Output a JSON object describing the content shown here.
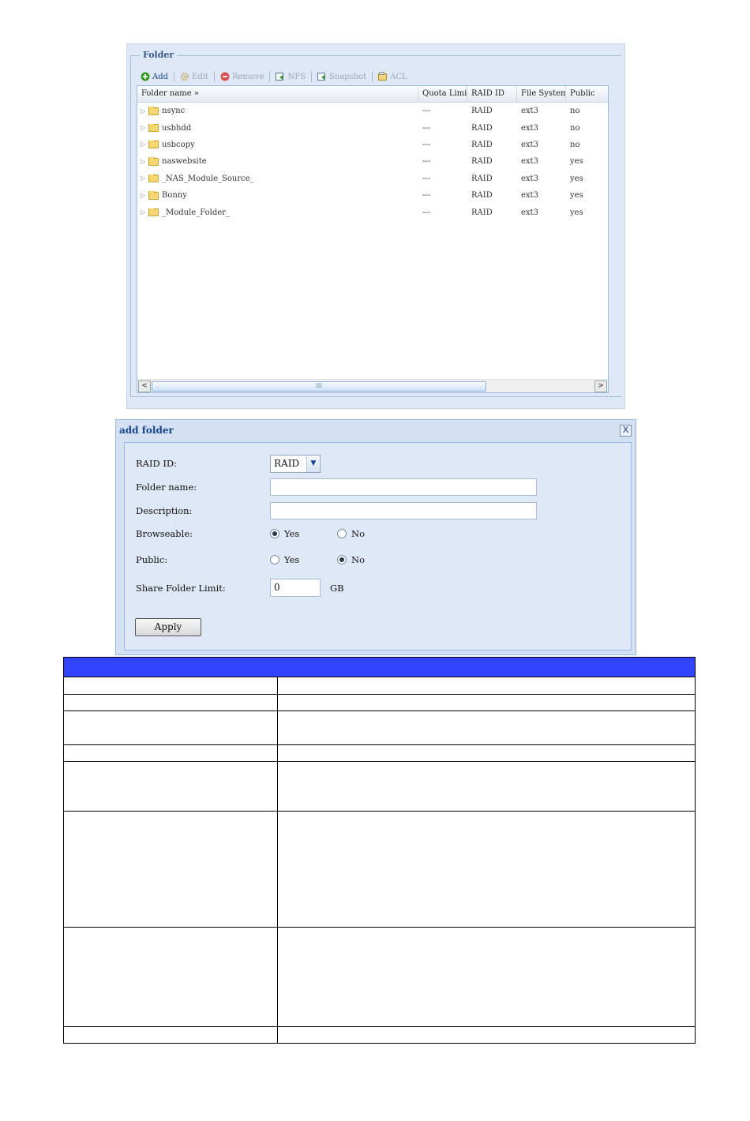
{
  "folder_panel": {
    "title": "Folder",
    "toolbar": [
      {
        "label": "Add",
        "icon": "add-icon",
        "enabled": true
      },
      {
        "label": "Edit",
        "icon": "edit-icon",
        "enabled": false
      },
      {
        "label": "Remove",
        "icon": "remove-icon",
        "enabled": false
      },
      {
        "label": "NFS",
        "icon": "nfs-icon",
        "enabled": false
      },
      {
        "label": "Snapshot",
        "icon": "snapshot-icon",
        "enabled": false
      },
      {
        "label": "ACL",
        "icon": "acl-icon",
        "enabled": false
      }
    ],
    "columns": [
      "Folder name »",
      "Quota Limit",
      "RAID ID",
      "File System",
      "Public"
    ],
    "rows": [
      {
        "name": "nsync",
        "quota": "---",
        "raid": "RAID",
        "fs": "ext3",
        "public": "no"
      },
      {
        "name": "usbhdd",
        "quota": "---",
        "raid": "RAID",
        "fs": "ext3",
        "public": "no"
      },
      {
        "name": "usbcopy",
        "quota": "---",
        "raid": "RAID",
        "fs": "ext3",
        "public": "no"
      },
      {
        "name": "naswebsite",
        "quota": "---",
        "raid": "RAID",
        "fs": "ext3",
        "public": "yes"
      },
      {
        "name": "_NAS_Module_Source_",
        "quota": "---",
        "raid": "RAID",
        "fs": "ext3",
        "public": "yes"
      },
      {
        "name": "Bonny",
        "quota": "---",
        "raid": "RAID",
        "fs": "ext3",
        "public": "yes"
      },
      {
        "name": "_Module_Folder_",
        "quota": "---",
        "raid": "RAID",
        "fs": "ext3",
        "public": "yes"
      }
    ],
    "scrollbar": {
      "left": "<",
      "right": ">",
      "grip": "III"
    }
  },
  "dialog": {
    "title": "add folder",
    "close": "X",
    "labels": {
      "raid_id": "RAID ID:",
      "folder_name": "Folder name:",
      "description": "Description:",
      "browseable": "Browseable:",
      "public": "Public:",
      "share_limit": "Share Folder Limit:"
    },
    "raid_value": "RAID",
    "folder_name_value": "",
    "description_value": "",
    "options": {
      "yes": "Yes",
      "no": "No"
    },
    "browseable_selected": "yes",
    "public_selected": "no",
    "limit_value": "0",
    "limit_unit": "GB",
    "apply_label": "Apply"
  },
  "colors": {
    "table_header": "#3344ff",
    "panel_bg": "#dfe8f6"
  }
}
